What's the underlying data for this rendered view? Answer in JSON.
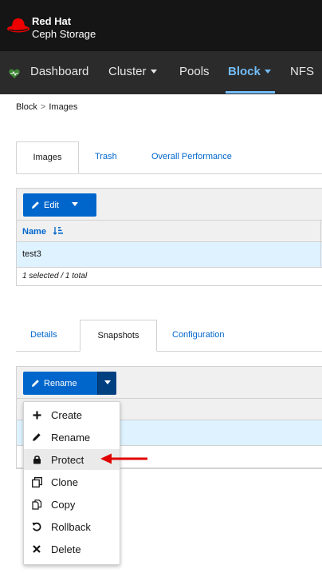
{
  "brand": {
    "line1": "Red Hat",
    "line2": "Ceph Storage"
  },
  "nav": {
    "items": [
      {
        "label": "Dashboard",
        "active": false,
        "has_caret": false
      },
      {
        "label": "Cluster",
        "active": false,
        "has_caret": true
      },
      {
        "label": "Pools",
        "active": false,
        "has_caret": false
      },
      {
        "label": "Block",
        "active": true,
        "has_caret": true
      },
      {
        "label": "NFS",
        "active": false,
        "has_caret": false
      }
    ]
  },
  "breadcrumb": {
    "parent": "Block",
    "separator": ">",
    "current": "Images"
  },
  "images_tabs": [
    {
      "label": "Images",
      "active": true
    },
    {
      "label": "Trash",
      "active": false
    },
    {
      "label": "Overall Performance",
      "active": false
    }
  ],
  "images_table": {
    "edit_button": "Edit",
    "column_name": "Name",
    "rows": [
      {
        "name": "test3",
        "selected": true
      }
    ],
    "footer": "1 selected / 1 total"
  },
  "detail_tabs": [
    {
      "label": "Details",
      "active": false
    },
    {
      "label": "Snapshots",
      "active": true
    },
    {
      "label": "Configuration",
      "active": false
    }
  ],
  "snapshots": {
    "rename_button": "Rename",
    "menu": [
      {
        "label": "Create",
        "icon": "plus-icon",
        "highlighted": false
      },
      {
        "label": "Rename",
        "icon": "pencil-icon",
        "highlighted": false
      },
      {
        "label": "Protect",
        "icon": "lock-icon",
        "highlighted": true
      },
      {
        "label": "Clone",
        "icon": "clone-icon",
        "highlighted": false
      },
      {
        "label": "Copy",
        "icon": "copy-icon",
        "highlighted": false
      },
      {
        "label": "Rollback",
        "icon": "undo-icon",
        "highlighted": false
      },
      {
        "label": "Delete",
        "icon": "times-icon",
        "highlighted": false
      }
    ]
  },
  "colors": {
    "primary": "#0066cc",
    "nav_active": "#73bcf7",
    "selected_row": "#def3ff",
    "annotation_arrow": "#e00000",
    "brand_red": "#ee0000"
  }
}
